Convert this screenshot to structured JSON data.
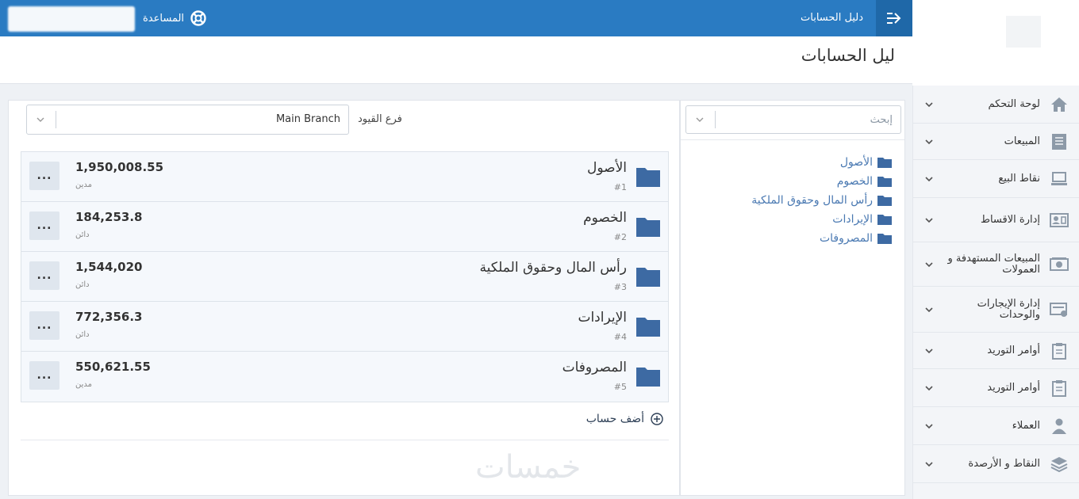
{
  "topbar": {
    "app_title": "دليل الحسابات",
    "help_label": "المساعدة"
  },
  "page": {
    "title": "ليل الحسابات"
  },
  "sidebar": {
    "items": [
      {
        "label": "لوحة التحكم",
        "icon": "home-icon"
      },
      {
        "label": "المبيعات",
        "icon": "invoice-icon"
      },
      {
        "label": "نقاط البيع",
        "icon": "laptop-icon"
      },
      {
        "label": "إدارة الاقساط",
        "icon": "id-card-icon"
      },
      {
        "label": "المبيعات المستهدفة و العمولات",
        "icon": "money-icon"
      },
      {
        "label": "إدارة الإيجارات والوحدات",
        "icon": "rental-icon"
      },
      {
        "label": "أوامر التوريد",
        "icon": "clipboard-icon"
      },
      {
        "label": "أوامر التوريد",
        "icon": "clipboard-icon"
      },
      {
        "label": "العملاء",
        "icon": "user-icon"
      },
      {
        "label": "النقاط و الأرصدة",
        "icon": "layers-icon"
      }
    ]
  },
  "tree": {
    "search_placeholder": "إبحث",
    "items": [
      "الأصول",
      "الخصوم",
      "رأس المال وحقوق الملكية",
      "الإيرادات",
      "المصروفات"
    ]
  },
  "main": {
    "branch_label": "فرع القيود",
    "branch_value": "Main Branch",
    "accounts": [
      {
        "name": "الأصول",
        "number": "#1",
        "balance": "1,950,008.55",
        "type": "مدين"
      },
      {
        "name": "الخصوم",
        "number": "#2",
        "balance": "184,253.8",
        "type": "دائن"
      },
      {
        "name": "رأس المال وحقوق الملكية",
        "number": "#3",
        "balance": "1,544,020",
        "type": "دائن"
      },
      {
        "name": "الإيرادات",
        "number": "#4",
        "balance": "772,356.3",
        "type": "دائن"
      },
      {
        "name": "المصروفات",
        "number": "#5",
        "balance": "550,621.55",
        "type": "مدين"
      }
    ],
    "more_label": "...",
    "add_account_label": "أضف حساب"
  },
  "watermark": "خمسات",
  "colors": {
    "topbar": "#2a7bc2",
    "menu_button": "#1f68a8",
    "folder": "#3d6aa3",
    "tree_text": "#4a79b2",
    "sidebar_icon": "#8d9aa8"
  }
}
